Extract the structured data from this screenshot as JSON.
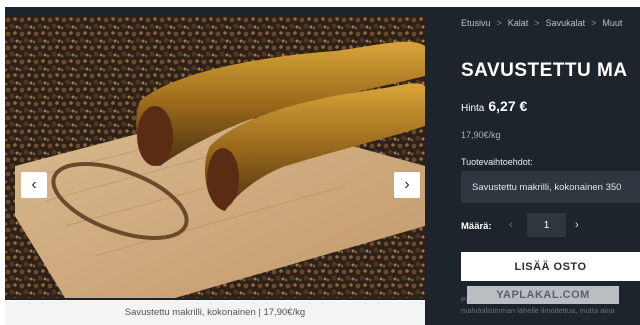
{
  "gallery": {
    "prev_icon": "chevron-left-icon",
    "next_icon": "chevron-right-icon",
    "caption": "Savustettu makrilli, kokonainen | 17,90€/kg",
    "prev_glyph": "‹",
    "next_glyph": "›"
  },
  "breadcrumb": {
    "items": [
      "Etusivu",
      "Kalat",
      "Savukalat",
      "Muut"
    ],
    "separator": ">"
  },
  "product": {
    "title": "SAVUSTETTU MA",
    "price_label": "Hinta",
    "price_value": "6,27 €",
    "unit_price": "17,90€/kg",
    "variants_label": "Tuotevaihtoehdot:",
    "variant_selected": "Savustettu makrilli, kokonainen 350",
    "quantity_label": "Määrä:",
    "quantity_minus": "‹",
    "quantity_value": "1",
    "quantity_plus": "›",
    "add_button": "LISÄÄ OSTO",
    "note_line1": "Pa",
    "note_line2": "mahdollisimman lähelle ilmoitettua, mutta aina"
  },
  "watermark": "YAPLAKAL.COM",
  "colors": {
    "background": "#1d242b",
    "field": "#2e3740",
    "button": "#ffffff"
  }
}
